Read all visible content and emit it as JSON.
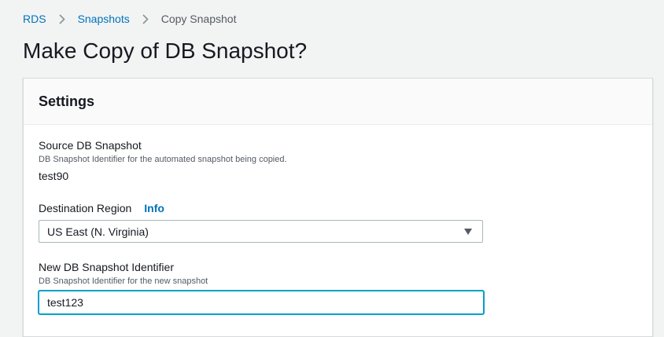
{
  "breadcrumb": {
    "items": [
      "RDS",
      "Snapshots"
    ],
    "current": "Copy Snapshot"
  },
  "page": {
    "title": "Make Copy of DB Snapshot?"
  },
  "settings": {
    "heading": "Settings",
    "source_snapshot": {
      "label": "Source DB Snapshot",
      "description": "DB Snapshot Identifier for the automated snapshot being copied.",
      "value": "test90"
    },
    "destination_region": {
      "label": "Destination Region",
      "info": "Info",
      "selected": "US East (N. Virginia)",
      "icon": "caret-down-icon"
    },
    "new_identifier": {
      "label": "New DB Snapshot Identifier",
      "description": "DB Snapshot Identifier for the new snapshot",
      "value": "test123"
    }
  },
  "colors": {
    "link": "#0073bb",
    "focus": "#00a1c9",
    "text": "#16191f",
    "muted": "#545b64",
    "background": "#f2f3f3"
  }
}
